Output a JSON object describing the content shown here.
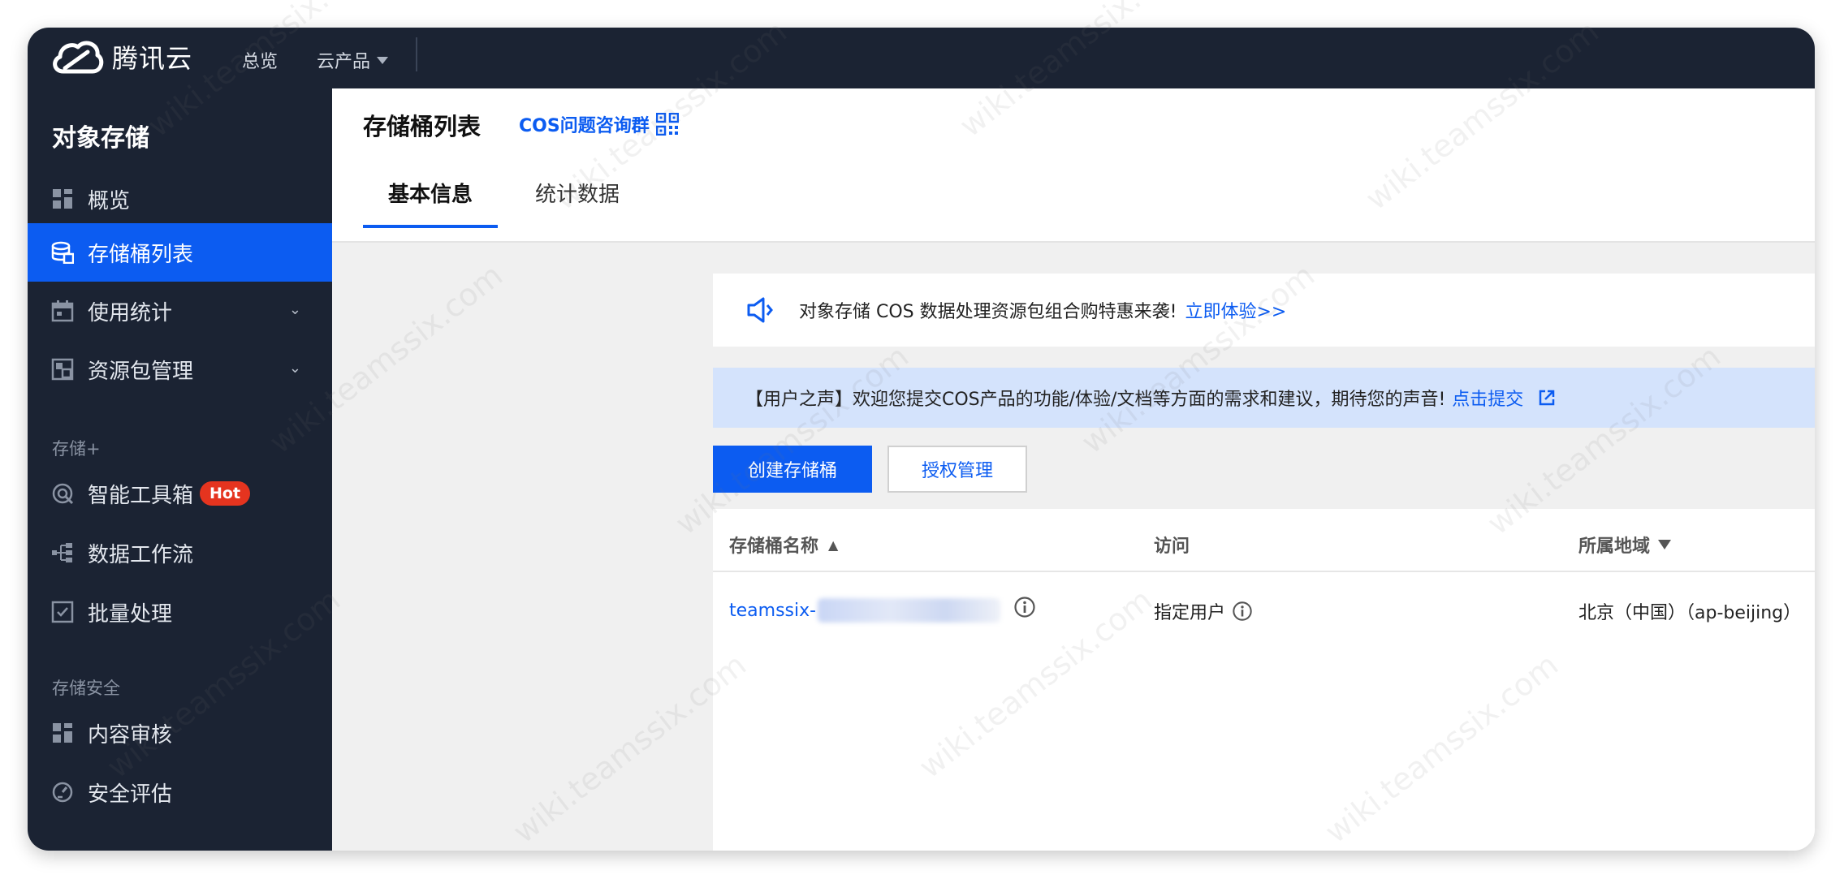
{
  "topbar": {
    "brand": "腾讯云",
    "nav_overview": "总览",
    "nav_products": "云产品"
  },
  "sidebar": {
    "title": "对象存储",
    "items": [
      {
        "label": "概览",
        "icon": "grid-icon"
      },
      {
        "label": "存储桶列表",
        "icon": "bucket-icon",
        "active": true
      },
      {
        "label": "使用统计",
        "icon": "calendar-icon",
        "expandable": true
      },
      {
        "label": "资源包管理",
        "icon": "package-icon",
        "expandable": true
      }
    ],
    "section_storage_plus": "存储+",
    "items_plus": [
      {
        "label": "智能工具箱",
        "icon": "toolbox-icon",
        "badge": "Hot"
      },
      {
        "label": "数据工作流",
        "icon": "workflow-icon"
      },
      {
        "label": "批量处理",
        "icon": "batch-icon"
      }
    ],
    "section_security": "存储安全",
    "items_security": [
      {
        "label": "内容审核",
        "icon": "grid-icon"
      },
      {
        "label": "安全评估",
        "icon": "gauge-icon"
      }
    ]
  },
  "header": {
    "title": "存储桶列表",
    "consult_link": "COS问题咨询群",
    "tabs": [
      {
        "label": "基本信息",
        "active": true
      },
      {
        "label": "统计数据"
      }
    ]
  },
  "notice": {
    "text": "对象存储 COS 数据处理资源包组合购特惠来袭!",
    "link": "立即体验>>"
  },
  "voice": {
    "text": "【用户之声】欢迎您提交COS产品的功能/体验/文档等方面的需求和建议，期待您的声音!",
    "link": "点击提交"
  },
  "buttons": {
    "create": "创建存储桶",
    "auth": "授权管理"
  },
  "table": {
    "columns": [
      "存储桶名称",
      "访问",
      "所属地域"
    ],
    "rows": [
      {
        "name": "teamssix-",
        "access": "指定用户",
        "region": "北京（中国）（ap-beijing）"
      }
    ]
  },
  "watermark": "wiki.teamssix.com",
  "colors": {
    "accent": "#0c5cf1",
    "sidebar_bg": "#1b2333",
    "hot_badge": "#e5341f",
    "voice_bg": "#d4e3fc"
  }
}
